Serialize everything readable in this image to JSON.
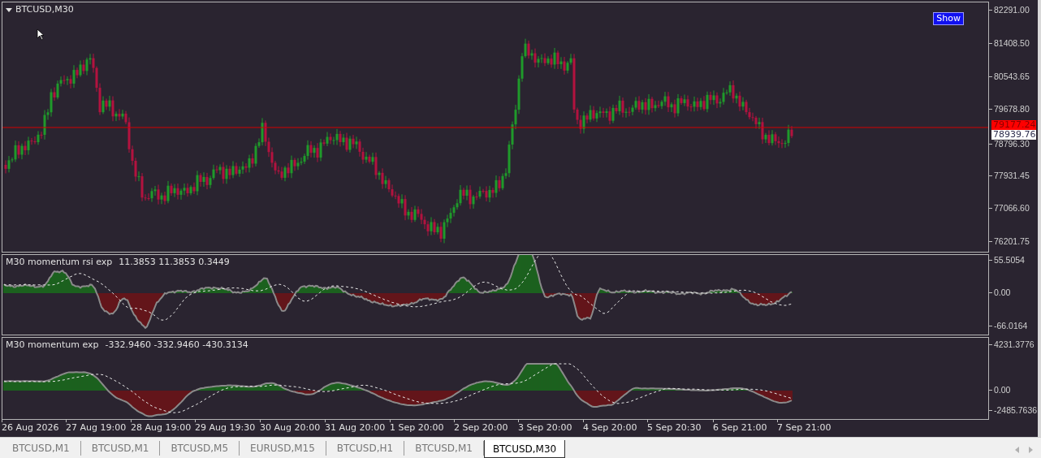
{
  "chart": {
    "title": "BTCUSD,M30",
    "show_button": "Show",
    "price_axis": [
      "82291.00",
      "81408.50",
      "80543.65",
      "79678.80",
      "78796.30",
      "77931.45",
      "77066.60",
      "76201.75"
    ],
    "bid_tag": "79177.24",
    "ask_tag": "78939.76"
  },
  "indicators": [
    {
      "label": "M30 momentum rsi exp",
      "values": "11.3853 11.3853 0.3449",
      "axis": [
        "55.5054",
        "0.00",
        "-66.0164"
      ]
    },
    {
      "label": "M30 momentum exp",
      "values": "-332.9460 -332.9460 -430.3134",
      "axis": [
        "4231.3776",
        "0.00",
        "-2485.7636"
      ]
    }
  ],
  "time_axis": [
    "26 Aug 2026",
    "27 Aug 19:00",
    "28 Aug 19:00",
    "29 Aug 19:30",
    "30 Aug 20:00",
    "31 Aug 20:00",
    "1 Sep 20:00",
    "2 Sep 20:00",
    "3 Sep 20:00",
    "4 Sep 20:00",
    "5 Sep 20:30",
    "6 Sep 21:00",
    "7 Sep 21:00"
  ],
  "tabs": [
    {
      "label": "BTCUSD,M1",
      "selected": false
    },
    {
      "label": "BTCUSD,M1",
      "selected": false
    },
    {
      "label": "BTCUSD,M5",
      "selected": false
    },
    {
      "label": "EURUSD,M15",
      "selected": false
    },
    {
      "label": "BTCUSD,H1",
      "selected": false
    },
    {
      "label": "BTCUSD,M1",
      "selected": false
    },
    {
      "label": "BTCUSD,M30",
      "selected": true
    }
  ]
}
